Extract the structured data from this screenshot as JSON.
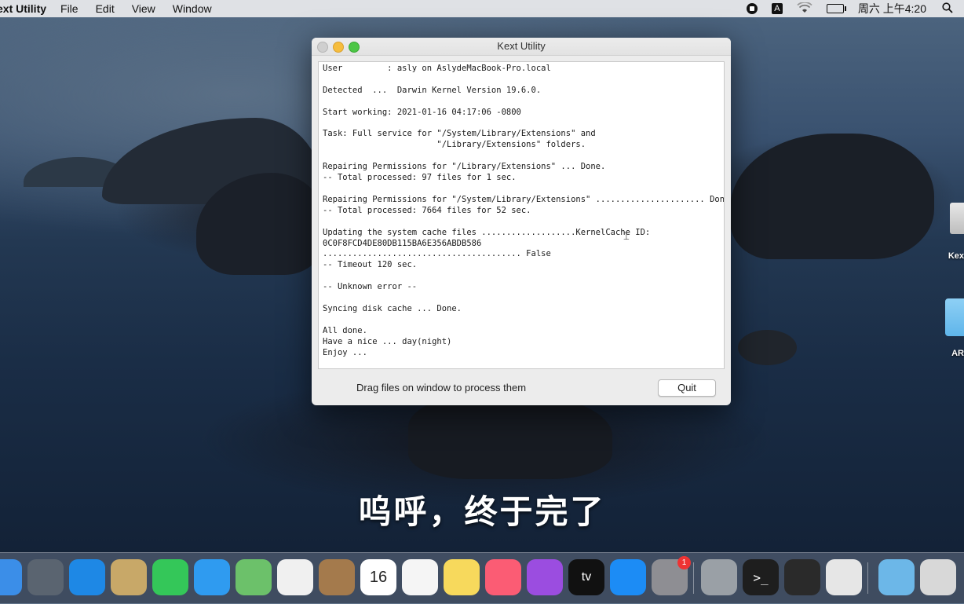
{
  "menubar": {
    "app_name": "ext Utility",
    "menus": [
      "File",
      "Edit",
      "View",
      "Window"
    ],
    "clock": "周六 上午4:20",
    "status_icons": [
      "screen-record-icon",
      "input-source-icon",
      "wifi-icon",
      "battery-icon",
      "spotlight-icon"
    ],
    "input_source": "A"
  },
  "window": {
    "title": "Kext Utility",
    "console_lines": [
      "User         : asly on AslydeMacBook-Pro.local",
      "",
      "Detected  ...  Darwin Kernel Version 19.6.0.",
      "",
      "Start working: 2021-01-16 04:17:06 -0800",
      "",
      "Task: Full service for \"/System/Library/Extensions\" and",
      "                       \"/Library/Extensions\" folders.",
      "",
      "Repairing Permissions for \"/Library/Extensions\" ... Done.",
      "-- Total processed: 97 files for 1 sec.",
      "",
      "Repairing Permissions for \"/System/Library/Extensions\" ...................... Done.",
      "-- Total processed: 7664 files for 52 sec.",
      "",
      "Updating the system cache files ...................KernelCache ID:",
      "0C0F8FCD4DE80DB115BA6E356ABDB586",
      "........................................ False",
      "-- Timeout 120 sec.",
      "",
      "-- Unknown error --",
      "",
      "Syncing disk cache ... Done.",
      "",
      "All done.",
      "Have a nice ... day(night)",
      "Enjoy ..."
    ],
    "footer_text": "Drag files on window to process them",
    "quit_label": "Quit"
  },
  "desktop": {
    "icons": [
      {
        "label": "Kex",
        "icon": "kext-utility-icon"
      },
      {
        "label": "AR",
        "icon": "folder-icon"
      }
    ]
  },
  "subtitle": "呜呼，终于完了",
  "dock": {
    "items": [
      {
        "name": "finder",
        "icon": "finder-icon",
        "color": "#3b8ee8"
      },
      {
        "name": "launchpad",
        "icon": "launchpad-icon",
        "color": "#5a6470"
      },
      {
        "name": "safari",
        "icon": "safari-icon",
        "color": "#1e88e5"
      },
      {
        "name": "mail-stamp",
        "icon": "eagle-stamp-icon",
        "color": "#c8a868"
      },
      {
        "name": "facetime",
        "icon": "facetime-icon",
        "color": "#34c759"
      },
      {
        "name": "messages",
        "icon": "messages-icon",
        "color": "#2f9bf0"
      },
      {
        "name": "maps",
        "icon": "maps-icon",
        "color": "#6cc16a"
      },
      {
        "name": "photos",
        "icon": "photos-icon",
        "color": "#f0f0f0"
      },
      {
        "name": "contacts",
        "icon": "contacts-icon",
        "color": "#a47a4c"
      },
      {
        "name": "calendar",
        "icon": "calendar-icon",
        "color": "#ffffff",
        "text": "16",
        "month": "1月"
      },
      {
        "name": "reminders",
        "icon": "reminders-icon",
        "color": "#f5f5f5"
      },
      {
        "name": "notes",
        "icon": "notes-icon",
        "color": "#f7d95c"
      },
      {
        "name": "music",
        "icon": "music-icon",
        "color": "#fb5c74"
      },
      {
        "name": "podcasts",
        "icon": "podcasts-icon",
        "color": "#9b4de0"
      },
      {
        "name": "apple-tv",
        "icon": "apple-tv-icon",
        "color": "#111111",
        "text": "tv"
      },
      {
        "name": "app-store",
        "icon": "app-store-icon",
        "color": "#1c8cf5"
      },
      {
        "name": "system-preferences",
        "icon": "gear-icon",
        "color": "#8e8e93",
        "badge": "1"
      },
      {
        "name": "disk-utility",
        "icon": "disk-utility-icon",
        "color": "#9aa0a6"
      },
      {
        "name": "terminal",
        "icon": "terminal-icon",
        "color": "#1e1e1e",
        "text": ">_"
      },
      {
        "name": "quicktime",
        "icon": "quicktime-icon",
        "color": "#2a2a2a"
      },
      {
        "name": "kext-utility",
        "icon": "kext-utility-icon",
        "color": "#e6e6e6"
      },
      {
        "name": "downloads",
        "icon": "downloads-folder-icon",
        "color": "#6cb7e8"
      },
      {
        "name": "trash",
        "icon": "trash-icon",
        "color": "#d8d8d8"
      }
    ]
  }
}
